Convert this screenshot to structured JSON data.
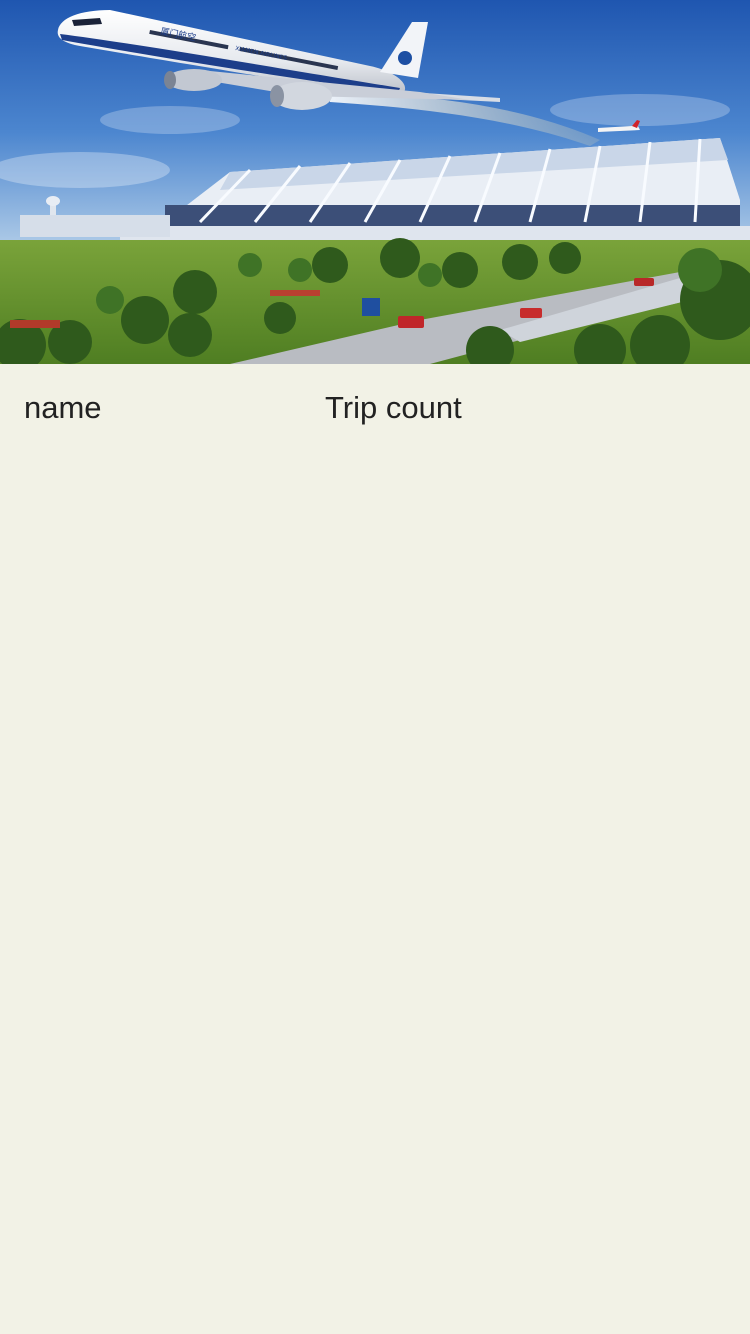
{
  "hero": {
    "image": "airport-terminal-with-airliner-photo",
    "aircraft_livery": "XIAMEN AIRLINES",
    "aircraft_livery_cn": "厦门航空"
  },
  "table": {
    "columns": [
      {
        "label": "name"
      },
      {
        "label": "Trip count"
      }
    ],
    "rows": []
  },
  "colors": {
    "page_background": "#f2f2e6",
    "text": "#222222",
    "sky": "#2f66b8"
  }
}
